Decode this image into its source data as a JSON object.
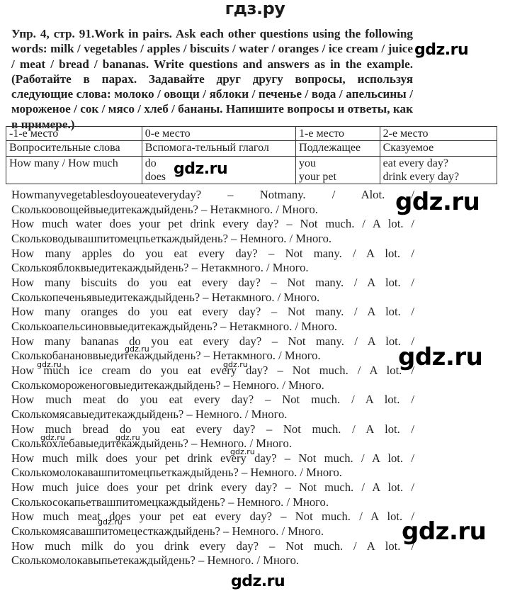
{
  "header": {
    "site_name": "гдз.ру"
  },
  "task": {
    "text": "Упр. 4, стр. 91.Work in pairs. Ask each other questions using the following words: milk / vegetables / apples / biscuits / water / oranges / ice cream / juice / meat / bread / bananas. Write questions and answers as in the example. (Работайте в парах. Задавайте друг другу вопросы, используя следующие слова: молоко / овощи / яблоки / печенье / вода / апельсины / мороженое / сок / мясо / хлеб / бананы. Напишите вопросы и ответы, как в примере.)"
  },
  "table": {
    "rows": [
      [
        "-1-е место",
        "0-е место",
        "1-е место",
        "2-е место"
      ],
      [
        "Вопросительные слова",
        "Вспомога-тельный глагол",
        "Подлежащее",
        "Сказуемое"
      ],
      [
        [
          "How many / How much"
        ],
        [
          "do",
          "does"
        ],
        [
          "you",
          "your pet"
        ],
        [
          "eat every day?",
          "drink every day?"
        ]
      ]
    ]
  },
  "answers": [
    {
      "en": "Howmanyvegetablesdoyoueateveryday? – Notmany. / Alot. /",
      "ru": "Сколькоовощейвыедитекаждыйдень? – Нетакмного. / Много."
    },
    {
      "en": "How much water does your pet drink every day? – Not much. / A lot. /",
      "ru": "Скольководывашпитомецпьеткаждыйдень? – Немного. / Много."
    },
    {
      "en": "How many apples do you eat every day? – Not many. / A lot. /",
      "ru": "Сколькояблоквыедитекаждыйдень? – Нетакмного. / Много."
    },
    {
      "en": "How many biscuits do you eat every day? – Not many. / A lot. /",
      "ru": "Сколькопеченьявыедитекаждыйдень? – Нетакмного. / Много."
    },
    {
      "en": "How many oranges do you eat every day? – Not many. / A lot. /",
      "ru": "Сколькоапельсиноввыедитекаждыйдень? – Нетакмного. / Много."
    },
    {
      "en": "How many bananas do you eat every day? – Not many. / A lot. /",
      "ru": "Сколькобанановвыедитекаждыйдень? – Нетакмного. / Много."
    },
    {
      "en": "How much ice cream do you eat every day? – Not much. / A lot. /",
      "ru": "Сколькомороженоговыедитекаждыйдень? – Немного. / Много."
    },
    {
      "en": "How much meat do you eat every day? – Not much. / A lot. /",
      "ru": "Сколькомясавыедитекаждыйдень? – Немного. / Много."
    },
    {
      "en": "How much bread do you eat every day? – Not much. / A lot. /",
      "ru": "Сколькохлебавыедитекаждыйдень? – Немного. / Много."
    },
    {
      "en": "How much milk does your pet drink every day? – Not much. / A lot. /",
      "ru": "Сколькомолокавашпитомецпьеткаждыйдень? – Немного. / Много."
    },
    {
      "en": "How much juice does your pet drink every day? – Not much. / A lot. /",
      "ru": "Сколькосокапьетвашпитомецкаждыйдень? – Немного. / Много."
    },
    {
      "en": "How much meat does your pet eat every day? – Not much. / A lot. /",
      "ru": "Сколькомясавашпитомецесткаждыйдень? – Немного. / Много."
    },
    {
      "en": "How much milk do you drink every day? – Not much. / A lot. /",
      "ru": "Сколькомолокавыпьетекаждыйдень? – Немного. / Много."
    }
  ],
  "watermarks": {
    "large": "gdz.ru",
    "small": "gdz.ru"
  }
}
